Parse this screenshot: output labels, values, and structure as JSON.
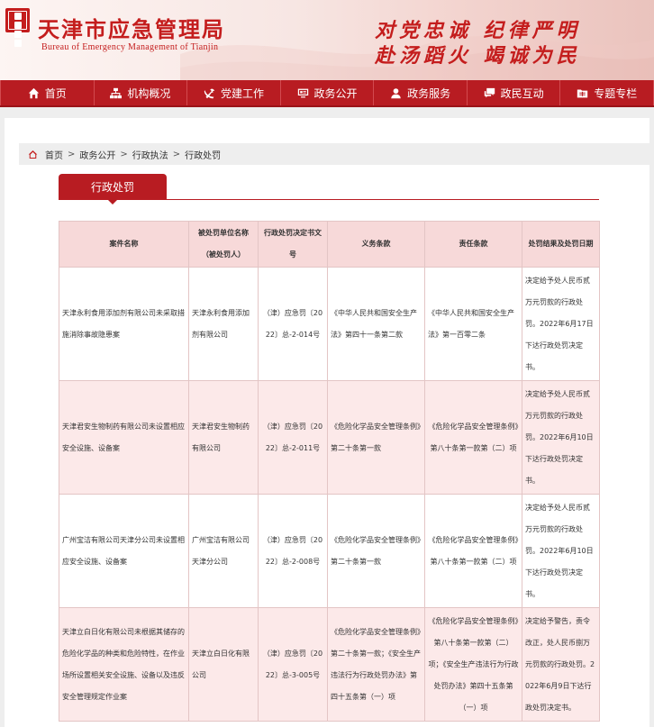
{
  "header": {
    "title": "天津市应急管理局",
    "subtitle": "Bureau  of Emergency Management  of Tianjin",
    "slogan_line1": "对党忠诚  纪律严明",
    "slogan_line2": "赴汤蹈火  竭诚为民",
    "accent_color": "#c41d1d"
  },
  "nav": {
    "items": [
      {
        "label": "首页",
        "icon": "home-icon"
      },
      {
        "label": "机构概况",
        "icon": "org-chart-icon"
      },
      {
        "label": "党建工作",
        "icon": "party-emblem-icon"
      },
      {
        "label": "政务公开",
        "icon": "monitor-icon"
      },
      {
        "label": "政务服务",
        "icon": "user-service-icon"
      },
      {
        "label": "政民互动",
        "icon": "chat-icon"
      },
      {
        "label": "专题专栏",
        "icon": "folder-icon"
      }
    ]
  },
  "breadcrumb": {
    "icon": "home-icon",
    "items": [
      "首页",
      "政务公开",
      "行政执法",
      "行政处罚"
    ],
    "separator": ">"
  },
  "section": {
    "title": "行政处罚"
  },
  "table": {
    "headers": [
      "案件名称",
      "被处罚单位名称（被处罚人）",
      "行政处罚决定书文号",
      "义务条款",
      "责任条款",
      "处罚结果及处罚日期"
    ],
    "rows": [
      {
        "case": "天津永利食用添加剂有限公司未采取措施消除事故隐患案",
        "party": "天津永利食用添加剂有限公司",
        "doc_no": "（津）应急罚〔2022〕总-2-014号",
        "duty": "《中华人民共和国安全生产法》第四十一条第二款",
        "liability": "《中华人民共和国安全生产法》第一百零二条",
        "result": "决定给予处人民币贰万元罚款的行政处罚。2022年6月17日下达行政处罚决定书。"
      },
      {
        "case": "天津君安生物制药有限公司未设置相应安全设施、设备案",
        "party": "天津君安生物制药有限公司",
        "doc_no": "（津）应急罚〔2022〕总-2-011号",
        "duty": "《危险化学品安全管理条例》第二十条第一款",
        "liability": "《危险化学品安全管理条例》第八十条第一款第（二）项",
        "result": "决定给予处人民币贰万元罚款的行政处罚。2022年6月10日下达行政处罚决定书。"
      },
      {
        "case": "广州宝洁有限公司天津分公司未设置相应安全设施、设备案",
        "party": "广州宝洁有限公司天津分公司",
        "doc_no": "（津）应急罚〔2022〕总-2-008号",
        "duty": "《危险化学品安全管理条例》第二十条第一款",
        "liability": "《危险化学品安全管理条例》第八十条第一款第（二）项",
        "result": "决定给予处人民币贰万元罚款的行政处罚。2022年6月10日下达行政处罚决定书。"
      },
      {
        "case": "天津立白日化有限公司未根据其储存的危险化学品的种类和危险特性，在作业场所设置相关安全设施、设备以及违反安全管理规定作业案",
        "party": "天津立白日化有限公司",
        "doc_no": "（津）应急罚〔2022〕总-3-005号",
        "duty": "《危险化学品安全管理条例》第二十条第一款；《安全生产违法行为行政处罚办法》第四十五条第（一）项",
        "liability": "《危险化学品安全管理条例》第八十条第一款第（二）项；《安全生产违法行为行政处罚办法》第四十五条第（一）项",
        "result": "决定给予警告，责令改正，处人民币捌万元罚款的行政处罚。2022年6月9日下达行政处罚决定书。"
      }
    ]
  }
}
